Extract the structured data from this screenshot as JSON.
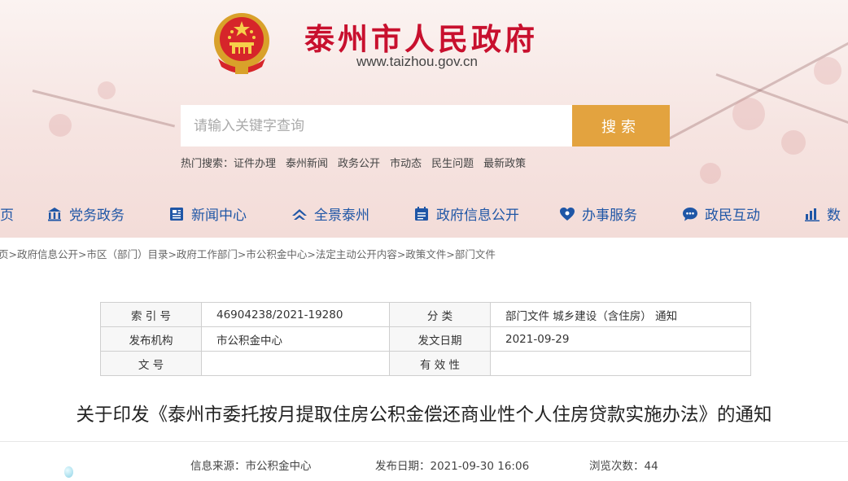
{
  "site": {
    "title": "泰州市人民政府",
    "url": "www.taizhou.gov.cn",
    "emblem_icon": "national-emblem-icon"
  },
  "search": {
    "placeholder": "请输入关键字查询",
    "button": "搜索",
    "hot_label": "热门搜索：",
    "hot_terms": [
      "证件办理",
      "泰州新闻",
      "政务公开",
      "市动态",
      "民生问题",
      "最新政策"
    ]
  },
  "nav": {
    "items": [
      {
        "label": "页",
        "icon": "home-icon"
      },
      {
        "label": "党务政务",
        "icon": "building-icon"
      },
      {
        "label": "新闻中心",
        "icon": "newspaper-icon"
      },
      {
        "label": "全景泰州",
        "icon": "panorama-icon"
      },
      {
        "label": "政府信息公开",
        "icon": "calendar-list-icon"
      },
      {
        "label": "办事服务",
        "icon": "service-icon"
      },
      {
        "label": "政民互动",
        "icon": "chat-icon"
      },
      {
        "label": "数",
        "icon": "chart-icon"
      }
    ]
  },
  "breadcrumb": "页>政府信息公开>市区（部门）目录>政府工作部门>市公积金中心>法定主动公开内容>政策文件>部门文件",
  "meta": {
    "index_label": "索 引 号",
    "index_value": "46904238/2021-19280",
    "category_label": "分 类",
    "category_value": "部门文件 城乡建设（含住房） 通知",
    "publisher_label": "发布机构",
    "publisher_value": "市公积金中心",
    "date_label": "发文日期",
    "date_value": "2021-09-29",
    "docno_label": "文 号",
    "docno_value": "",
    "validity_label": "有 效 性",
    "validity_value": ""
  },
  "article": {
    "title": "关于印发《泰州市委托按月提取住房公积金偿还商业性个人住房贷款实施办法》的通知",
    "source_label": "信息来源：",
    "source_value": "市公积金中心",
    "published_label": "发布日期：",
    "published_value": "2021-09-30 16:06",
    "views_label": "浏览次数：",
    "views_value": "44"
  },
  "colors": {
    "brand_red": "#c8102e",
    "nav_blue": "#1f56a6",
    "search_button": "#e3a33f"
  }
}
